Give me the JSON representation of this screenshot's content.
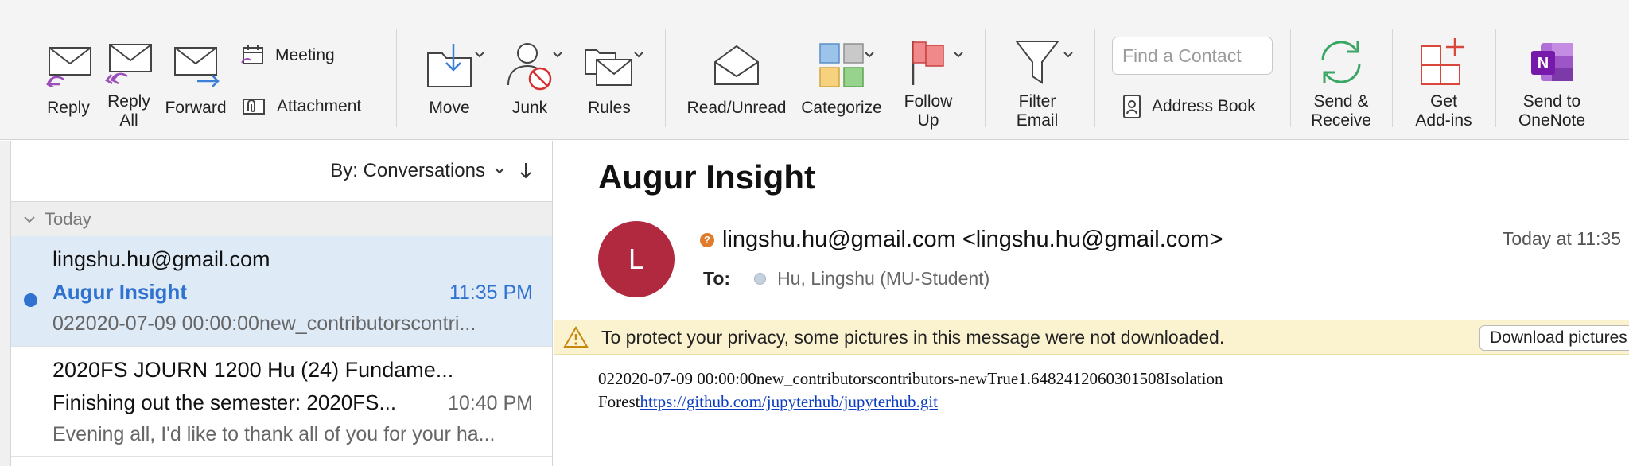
{
  "ribbon": {
    "reply": "Reply",
    "reply_all": "Reply\nAll",
    "forward": "Forward",
    "meeting": "Meeting",
    "attachment": "Attachment",
    "move": "Move",
    "junk": "Junk",
    "rules": "Rules",
    "read_unread": "Read/Unread",
    "categorize": "Categorize",
    "follow_up": "Follow\nUp",
    "filter_email": "Filter\nEmail",
    "find_contact_placeholder": "Find a Contact",
    "address_book": "Address Book",
    "send_receive": "Send &\nReceive",
    "get_addins": "Get\nAdd-ins",
    "send_onenote": "Send to\nOneNote"
  },
  "list": {
    "sort_label": "By: Conversations",
    "group_today": "Today",
    "messages": [
      {
        "from": "lingshu.hu@gmail.com",
        "subject": "Augur Insight",
        "time": "11:35 PM",
        "preview": "022020-07-09 00:00:00new_contributorscontri...",
        "selected": true,
        "unread": true
      },
      {
        "from": "2020FS JOURN 1200 Hu (24) Fundame...",
        "subject": "Finishing out the semester: 2020FS...",
        "time": "10:40 PM",
        "preview": "Evening all, I'd like to thank all of you for your ha...",
        "selected": false,
        "unread": false
      }
    ]
  },
  "reader": {
    "subject": "Augur Insight",
    "avatar_initial": "L",
    "sender": "lingshu.hu@gmail.com <lingshu.hu@gmail.com>",
    "time": "Today at 11:35",
    "to_label": "To:",
    "recipient": "Hu, Lingshu (MU-Student)",
    "privacy_notice": "To protect your privacy, some pictures in this message were not downloaded.",
    "download_button": "Download pictures",
    "body_line1": "022020-07-09 00:00:00new_contributorscontributors-newTrue1.6482412060301508Isolation",
    "body_line2_prefix": "Forest",
    "body_link": "https://github.com/jupyterhub/jupyterhub.git"
  },
  "colors": {
    "accent": "#2f72d0",
    "avatar": "#b0293f",
    "selected_row": "#dfeaf7",
    "info_bar": "#fbf3d0"
  }
}
